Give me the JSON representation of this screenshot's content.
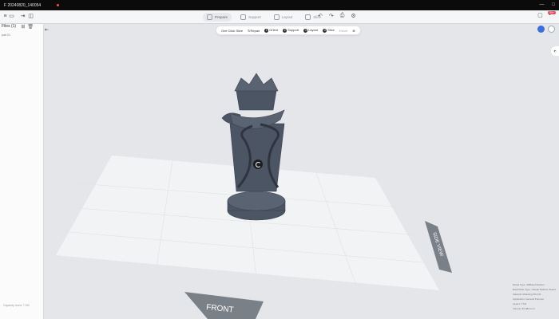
{
  "window": {
    "title": "F 20240820_140054",
    "controls": [
      "—",
      "□"
    ]
  },
  "toolbar": {
    "steps": [
      {
        "label": "Prepare",
        "active": true
      },
      {
        "label": "Support",
        "active": false
      },
      {
        "label": "Layout",
        "active": false
      },
      {
        "label": "Slice",
        "active": false
      }
    ],
    "notification_count": "99+"
  },
  "sidebar": {
    "title": "Files (1)",
    "file_label": "part 01",
    "footer": "Capacity Used: 7.2M"
  },
  "oneclick": {
    "title": "One Click Slice",
    "steps": [
      {
        "num": "",
        "label": "Repair"
      },
      {
        "num": "1",
        "label": "Orient"
      },
      {
        "num": "2",
        "label": "Support"
      },
      {
        "num": "3",
        "label": "Layout"
      },
      {
        "num": "4",
        "label": "Slice"
      }
    ],
    "reset": "Reset"
  },
  "plate": {
    "front_label": "FRONT",
    "side_label": "SIDE VIEW"
  },
  "colors": {
    "accent": "#3b6fe0",
    "model": "#4c5564",
    "plate": "#f1f3f5",
    "background": "#e4e6ea"
  },
  "info_lines": [
    "Model Type: 3DBase3 Refiner",
    "Build Plate Type: Tubular Balance Board",
    "Material: Modeling PR-V11",
    "Application: General Purpose",
    "Layers: 7741",
    "Volume: 82 983 mm³"
  ]
}
